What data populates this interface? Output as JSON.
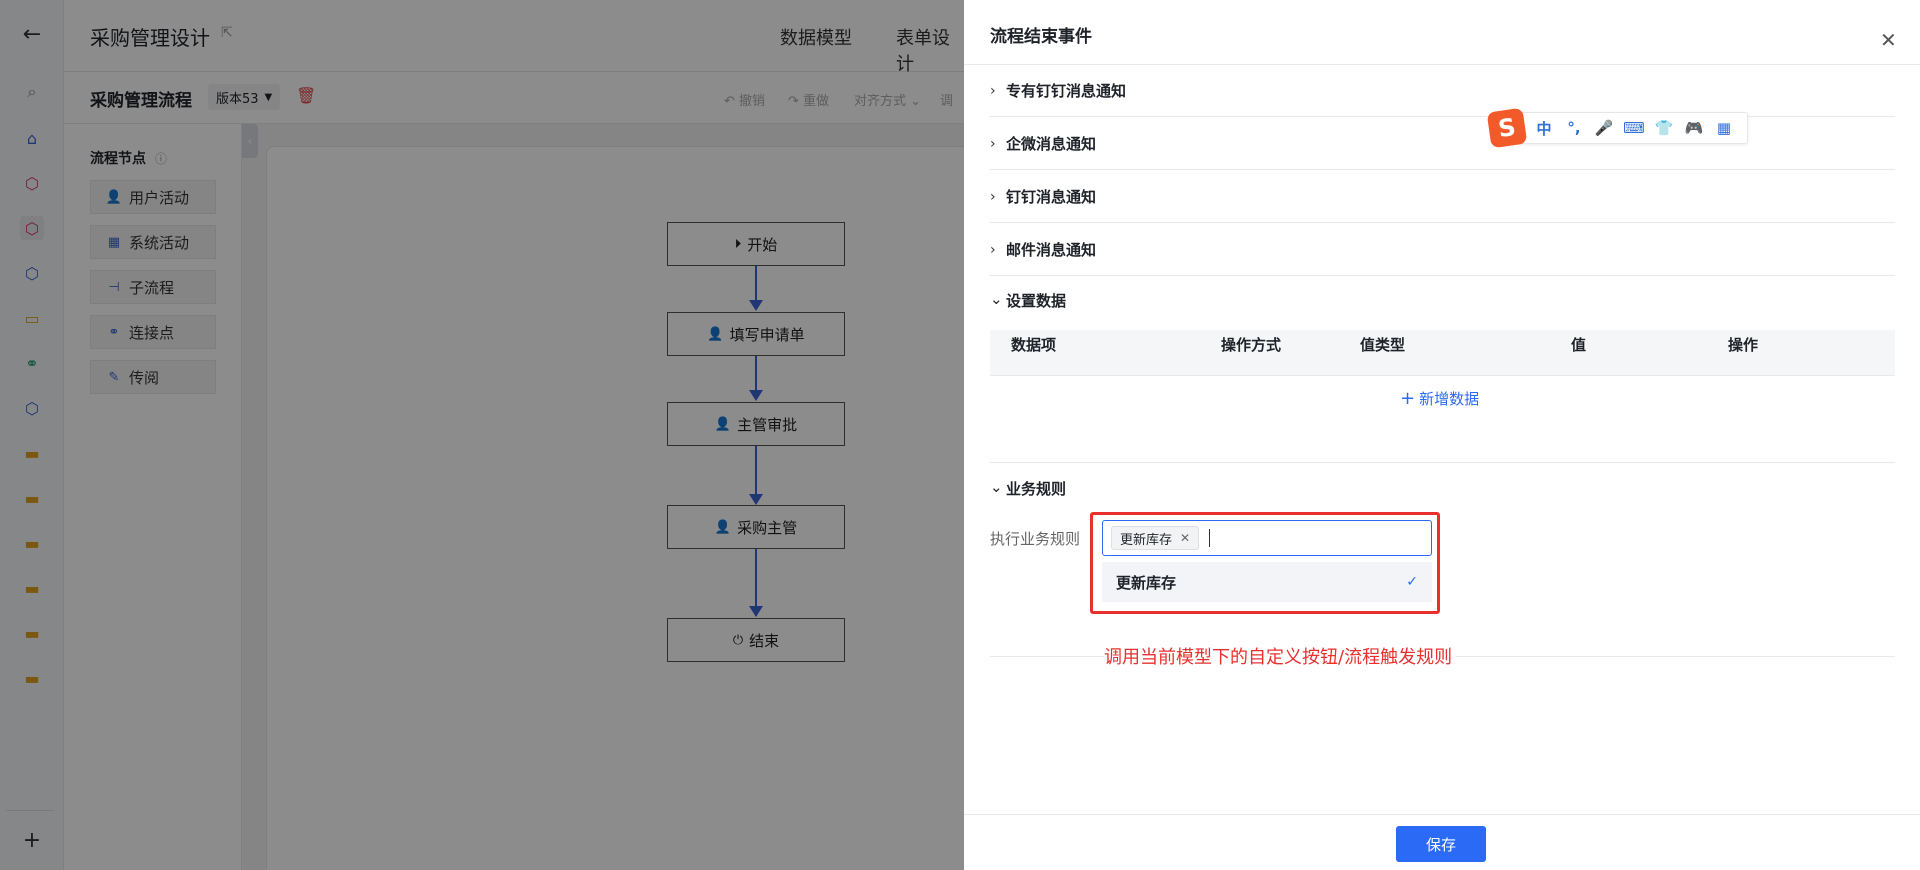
{
  "header": {
    "app_title": "采购管理设计",
    "tabs": [
      "数据模型",
      "表单设计"
    ]
  },
  "subbar": {
    "process_name": "采购管理流程",
    "version": "版本53",
    "toolbar": [
      "撤销",
      "重做",
      "对齐方式",
      "调"
    ]
  },
  "node_panel": {
    "title": "流程节点",
    "items": [
      "用户活动",
      "系统活动",
      "子流程",
      "连接点",
      "传阅"
    ]
  },
  "flow": {
    "nodes": [
      "开始",
      "填写申请单",
      "主管审批",
      "采购主管",
      "结束"
    ]
  },
  "drawer": {
    "title": "流程结束事件",
    "sections": [
      "专有钉钉消息通知",
      "企微消息通知",
      "钉钉消息通知",
      "邮件消息通知"
    ],
    "settings": {
      "title": "设置数据",
      "columns": [
        "数据项",
        "操作方式",
        "值类型",
        "值",
        "操作"
      ],
      "add_label": "新增数据"
    },
    "rules": {
      "title": "业务规则",
      "field_label": "执行业务规则",
      "selected_tag": "更新库存",
      "option": "更新库存"
    },
    "annotation": "调用当前模型下的自定义按钮/流程触发规则",
    "save_label": "保存"
  },
  "ime": {
    "logo": "S",
    "items": [
      "中",
      "°,",
      "🎤",
      "⌨",
      "👕",
      "🎮",
      "▦"
    ]
  },
  "colors": {
    "primary": "#2b6af5",
    "flow_edge": "#3b63d6",
    "annotation_red": "#e8312f",
    "mask": "rgba(0,0,0,0.45)"
  }
}
